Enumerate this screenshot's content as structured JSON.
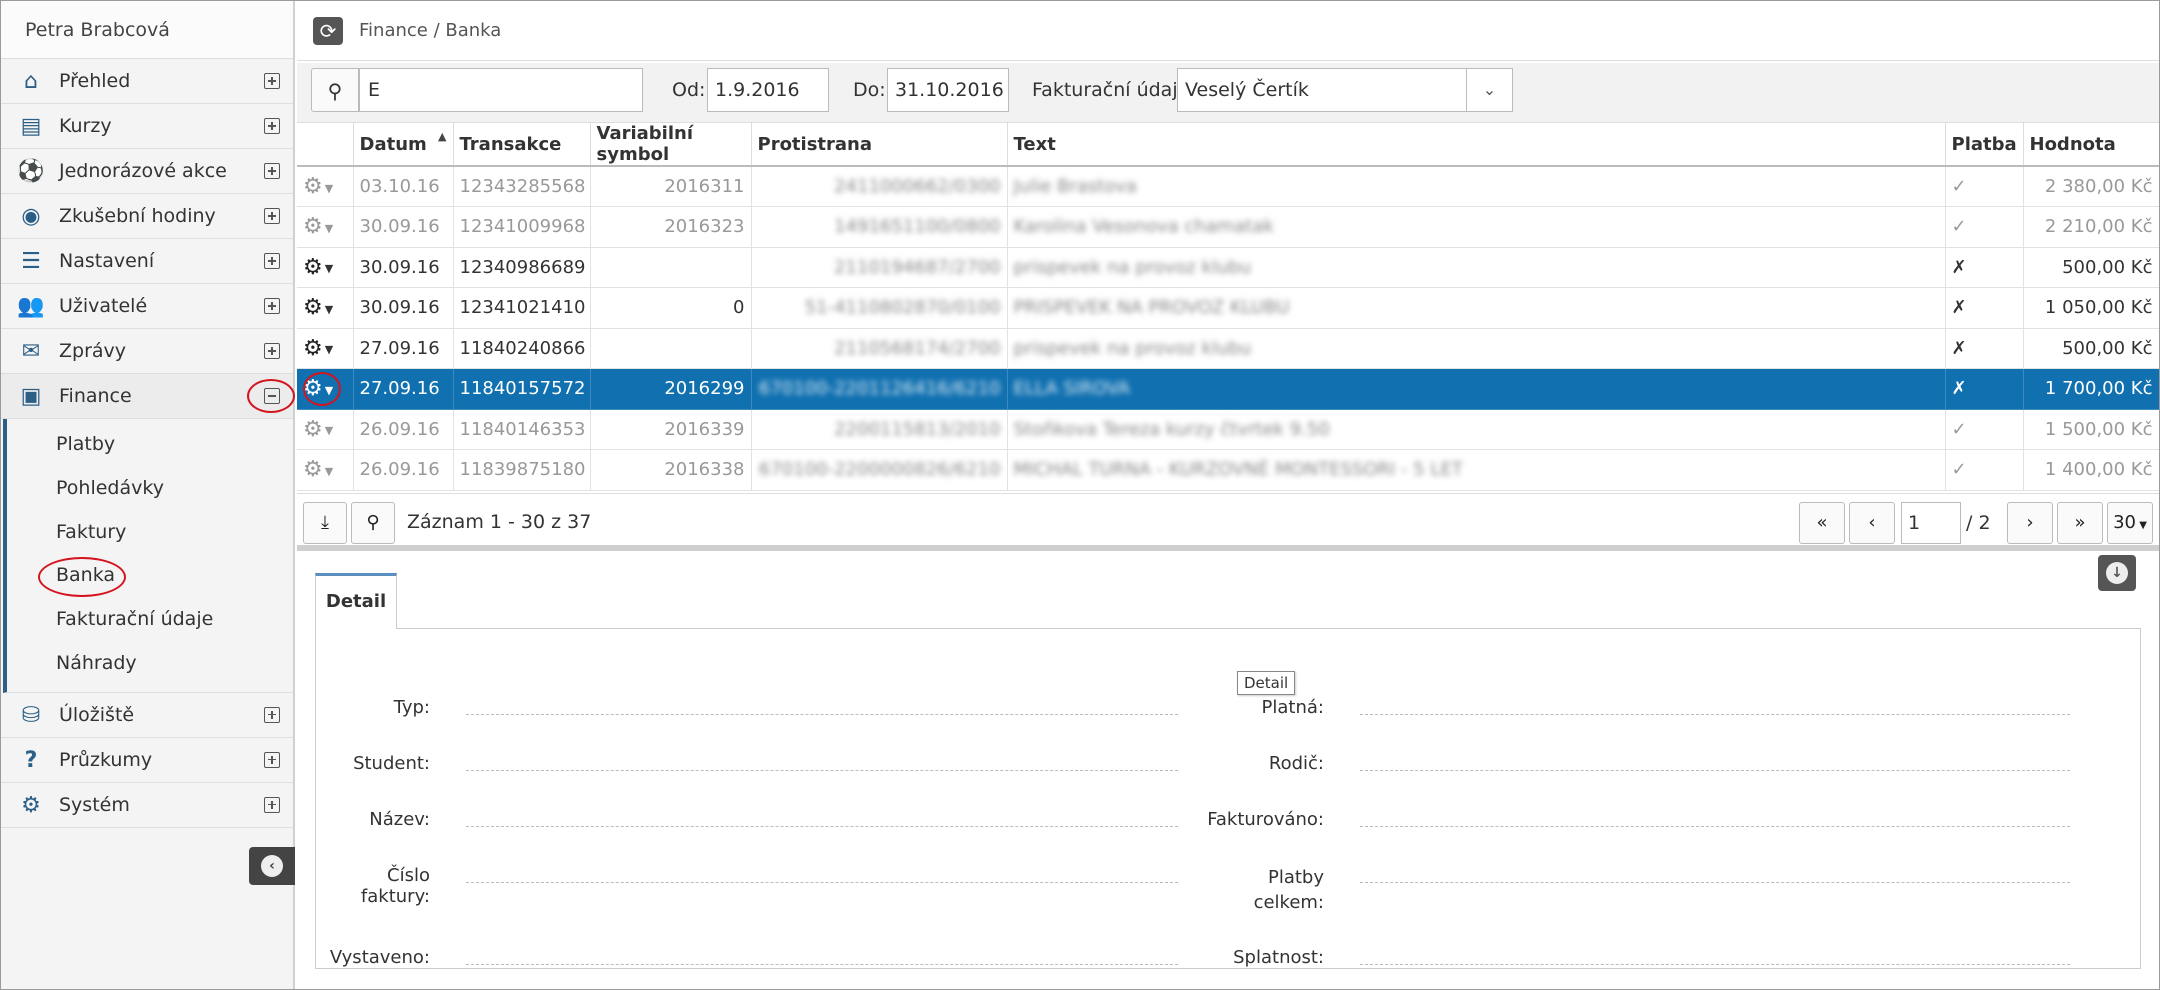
{
  "user": {
    "name": "Petra Brabcová"
  },
  "nav": {
    "items": [
      {
        "label": "Přehled",
        "icon": "home-icon"
      },
      {
        "label": "Kurzy",
        "icon": "book-icon"
      },
      {
        "label": "Jednorázové akce",
        "icon": "soccer-ball-icon"
      },
      {
        "label": "Zkušební hodiny",
        "icon": "eye-slash-icon"
      },
      {
        "label": "Nastavení",
        "icon": "server-icon"
      },
      {
        "label": "Uživatelé",
        "icon": "users-icon"
      },
      {
        "label": "Zprávy",
        "icon": "envelope-icon"
      },
      {
        "label": "Finance",
        "icon": "money-icon"
      }
    ],
    "finance_sub": [
      "Platby",
      "Pohledávky",
      "Faktury",
      "Banka",
      "Fakturační údaje",
      "Náhrady"
    ],
    "bottom_items": [
      {
        "label": "Úložiště",
        "icon": "database-icon"
      },
      {
        "label": "Průzkumy",
        "icon": "question-icon"
      },
      {
        "label": "Systém",
        "icon": "cogs-icon"
      }
    ]
  },
  "breadcrumb": "Finance / Banka",
  "filters": {
    "search_value": "E",
    "od_label": "Od:",
    "od_value": "1.9.2016",
    "do_label": "Do:",
    "do_value": "31.10.2016",
    "fakt_label": "Fakturační údaje:",
    "fakt_value": "Veselý Čertík"
  },
  "table": {
    "columns": [
      "",
      "Datum",
      "Transakce",
      "Variabilní symbol",
      "Protistrana",
      "Text",
      "Platba",
      "Hodnota"
    ],
    "rows": [
      {
        "datum": "03.10.16",
        "transakce": "12343285568",
        "vs": "2016311",
        "protistrana": "2411000662/0300",
        "text": "Julie Brastova",
        "platba": "✓",
        "hodnota": "2 380,00 Kč",
        "state": "faded"
      },
      {
        "datum": "30.09.16",
        "transakce": "12341009968",
        "vs": "2016323",
        "protistrana": "1491651100/0800",
        "text": "Karolina Vesonova chamatak",
        "platba": "✓",
        "hodnota": "2 210,00 Kč",
        "state": "faded"
      },
      {
        "datum": "30.09.16",
        "transakce": "12340986689",
        "vs": "",
        "protistrana": "2110194687/2700",
        "text": "prispevek na provoz klubu",
        "platba": "✗",
        "hodnota": "500,00 Kč",
        "state": "normal"
      },
      {
        "datum": "30.09.16",
        "transakce": "12341021410",
        "vs": "0",
        "protistrana": "51-4110802870/0100",
        "text": "PRISPEVEK NA PROVOZ KLUBU",
        "platba": "✗",
        "hodnota": "1 050,00 Kč",
        "state": "normal"
      },
      {
        "datum": "27.09.16",
        "transakce": "11840240866",
        "vs": "",
        "protistrana": "2110568174/2700",
        "text": "prispevek na provoz klubu",
        "platba": "✗",
        "hodnota": "500,00 Kč",
        "state": "normal"
      },
      {
        "datum": "27.09.16",
        "transakce": "11840157572",
        "vs": "2016299",
        "protistrana": "670100-2201126416/6210",
        "text": "ELLA SIROVA",
        "platba": "✗",
        "hodnota": "1 700,00 Kč",
        "state": "selected"
      },
      {
        "datum": "26.09.16",
        "transakce": "11840146353",
        "vs": "2016339",
        "protistrana": "2200115813/2010",
        "text": "Stoñkova Tereza kurzy čtvrtek 9.50",
        "platba": "✓",
        "hodnota": "1 500,00 Kč",
        "state": "faded"
      },
      {
        "datum": "26.09.16",
        "transakce": "11839875180",
        "vs": "2016338",
        "protistrana": "670100-2200000826/6210",
        "text": "MICHAL TURNA - KURZOVNÉ MONTESSORI - 5 LET",
        "platba": "✓",
        "hodnota": "1 400,00 Kč",
        "state": "faded"
      }
    ]
  },
  "pager": {
    "record_info": "Záznam 1 - 30 z 37",
    "page": "1",
    "total": "/ 2",
    "page_size": "30"
  },
  "detail": {
    "tab": "Detail",
    "tooltip": "Detail",
    "left_labels": [
      "Typ:",
      "Student:",
      "Název:",
      "Číslo faktury:",
      "Vystaveno:"
    ],
    "right_labels": [
      "Platná:",
      "Rodič:",
      "Fakturováno:",
      "Platby celkem:",
      "Splatnost:"
    ]
  },
  "colors": {
    "accent": "#1070b0",
    "nav_icon": "#2c5f86",
    "annotation": "#d4141d"
  }
}
